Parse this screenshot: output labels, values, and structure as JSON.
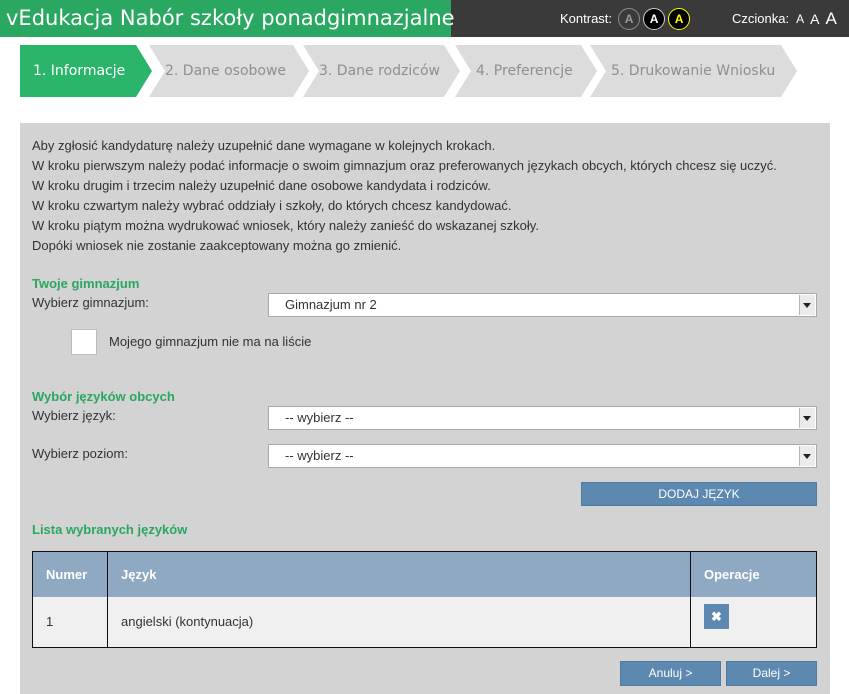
{
  "app": {
    "title": "vEdukacja Nabór szkoły ponadgimnazjalne"
  },
  "accessibility": {
    "contrast_label": "Kontrast:",
    "contrast_options": [
      "A",
      "A",
      "A"
    ],
    "font_label": "Czcionka:",
    "font_options": [
      "A",
      "A",
      "A"
    ]
  },
  "steps": [
    {
      "label": "1. Informacje",
      "active": true
    },
    {
      "label": "2. Dane osobowe",
      "active": false
    },
    {
      "label": "3. Dane rodziców",
      "active": false
    },
    {
      "label": "4. Preferencje",
      "active": false
    },
    {
      "label": "5. Drukowanie Wniosku",
      "active": false
    }
  ],
  "intro": [
    "Aby zgłosić kandydaturę należy uzupełnić dane wymagane w kolejnych krokach.",
    "W kroku pierwszym należy podać informacje o swoim gimnazjum oraz preferowanych językach obcych, których chcesz się uczyć.",
    "W kroku drugim i trzecim należy uzupełnić dane osobowe kandydata i rodziców.",
    "W kroku czwartym należy wybrać oddziały i szkoły, do których chcesz kandydować.",
    "W kroku piątym można wydrukować wniosek, który należy zanieść do wskazanej szkoły.",
    "Dopóki wniosek nie zostanie zaakceptowany można go zmienić."
  ],
  "school": {
    "section_title": "Twoje gimnazjum",
    "select_label": "Wybierz gimnazjum:",
    "selected": "Gimnazjum nr 2",
    "not_listed_label": "Mojego gimnazjum nie ma na liście",
    "not_listed_checked": false
  },
  "languages": {
    "section_title": "Wybór języków obcych",
    "language_label": "Wybierz język:",
    "language_selected": "-- wybierz --",
    "level_label": "Wybierz poziom:",
    "level_selected": "-- wybierz --",
    "add_button": "DODAJ JĘZYK"
  },
  "list": {
    "title": "Lista wybranych języków",
    "headers": [
      "Numer",
      "Język",
      "Operacje"
    ],
    "rows": [
      {
        "number": "1",
        "language": "angielski (kontynuacja)"
      }
    ],
    "delete_icon": "close-icon"
  },
  "actions": {
    "cancel": "Anuluj >",
    "next": "Dalej >"
  },
  "colors": {
    "brand_green": "#2aa760",
    "active_step": "#2bb56a",
    "button_blue": "#5d88b0",
    "table_header": "#8fa9c2",
    "panel_bg": "#d3d3d3",
    "topbar_bg": "#3a3a3a"
  }
}
